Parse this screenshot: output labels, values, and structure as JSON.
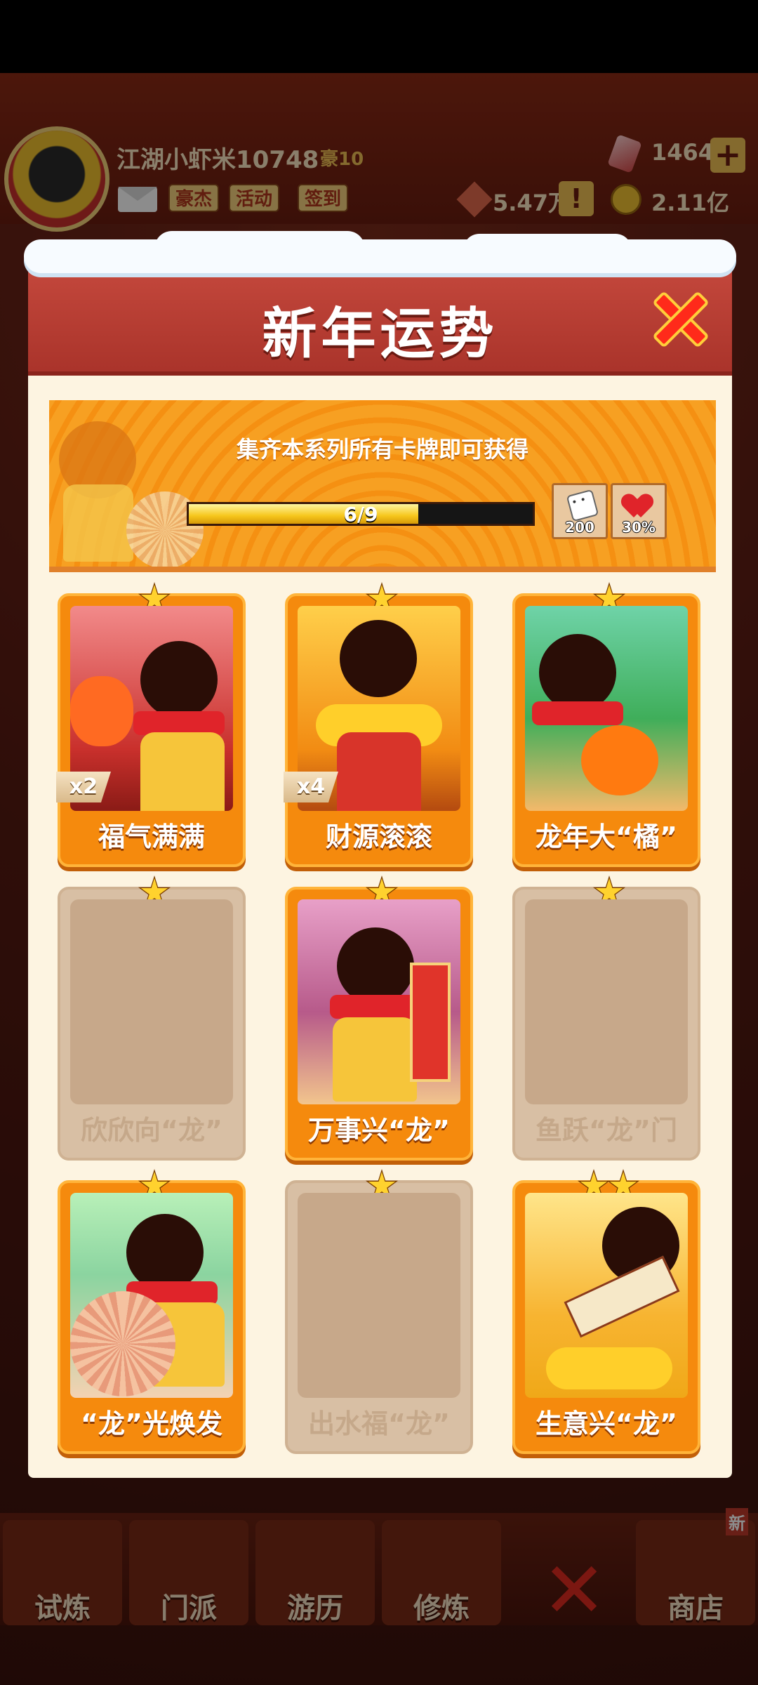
{
  "hud": {
    "player_name": "江湖小虾米10748",
    "player_title": "豪10",
    "buttons": [
      "豪杰",
      "活动",
      "签到"
    ],
    "gems": "1464",
    "token_amount": "5.47万",
    "coins": "2.11亿"
  },
  "nav": {
    "items": [
      "试炼",
      "门派",
      "游历",
      "修炼",
      "商店"
    ],
    "new_badge": "新"
  },
  "modal": {
    "title": "新年运势",
    "banner_text": "集齐本系列所有卡牌即可获得",
    "progress": {
      "label": "6/9",
      "current": 6,
      "total": 9
    },
    "rewards": [
      {
        "icon": "dice-icon",
        "label": "200"
      },
      {
        "icon": "heart-icon",
        "label": "30%"
      }
    ],
    "cards": [
      {
        "name": "福气满满",
        "collected": true,
        "count": "x2",
        "stars": 1
      },
      {
        "name": "财源滚滚",
        "collected": true,
        "count": "x4",
        "stars": 1
      },
      {
        "name": "龙年大“橘”",
        "collected": true,
        "count": "",
        "stars": 1
      },
      {
        "name": "欣欣向“龙”",
        "collected": false,
        "count": "",
        "stars": 1
      },
      {
        "name": "万事兴“龙”",
        "collected": true,
        "count": "",
        "stars": 1
      },
      {
        "name": "鱼跃“龙”门",
        "collected": false,
        "count": "",
        "stars": 1
      },
      {
        "name": "“龙”光焕发",
        "collected": true,
        "count": "",
        "stars": 1
      },
      {
        "name": "出水福“龙”",
        "collected": false,
        "count": "",
        "stars": 1
      },
      {
        "name": "生意兴“龙”",
        "collected": true,
        "count": "",
        "stars": 2
      }
    ]
  },
  "colors": {
    "accent": "#f58a0d",
    "header": "#b8392e",
    "locked": "#d8bfa4"
  }
}
